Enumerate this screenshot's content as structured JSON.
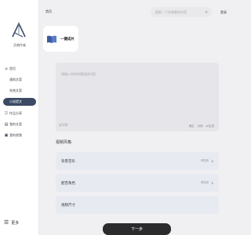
{
  "app": {
    "logo_text": "灵感作者"
  },
  "sidebar": {
    "items": [
      {
        "label": "首页",
        "icon": "home-icon",
        "glyph": "⌂"
      },
      {
        "label": "通知文案",
        "icon": "",
        "glyph": ""
      },
      {
        "label": "系统文案",
        "icon": "",
        "glyph": ""
      },
      {
        "label": "小说提文",
        "icon": "",
        "glyph": ""
      },
      {
        "label": "作品分享",
        "icon": "share-icon",
        "glyph": "⎋"
      },
      {
        "label": "我的文案",
        "icon": "document-icon",
        "glyph": "▤"
      },
      {
        "label": "我的视频",
        "icon": "video-icon",
        "glyph": "▣"
      }
    ],
    "more_label": "更多"
  },
  "topbar": {
    "breadcrumb": "首页",
    "search_placeholder": "搜索一下你想要的内容",
    "login_label": "登录"
  },
  "card": {
    "label": "一键成片"
  },
  "description": {
    "placeholder": "请输入你的创意描述内容",
    "count": "0/100",
    "tools": [
      "清空",
      "示例",
      "AI生成"
    ]
  },
  "section": {
    "title": "视频风格"
  },
  "rows": [
    {
      "label": "背景音乐",
      "value": "请选择"
    },
    {
      "label": "配音角色",
      "value": "请选择"
    },
    {
      "label": "视频尺寸",
      "value": ""
    }
  ],
  "next_button": {
    "label": "下一步"
  }
}
